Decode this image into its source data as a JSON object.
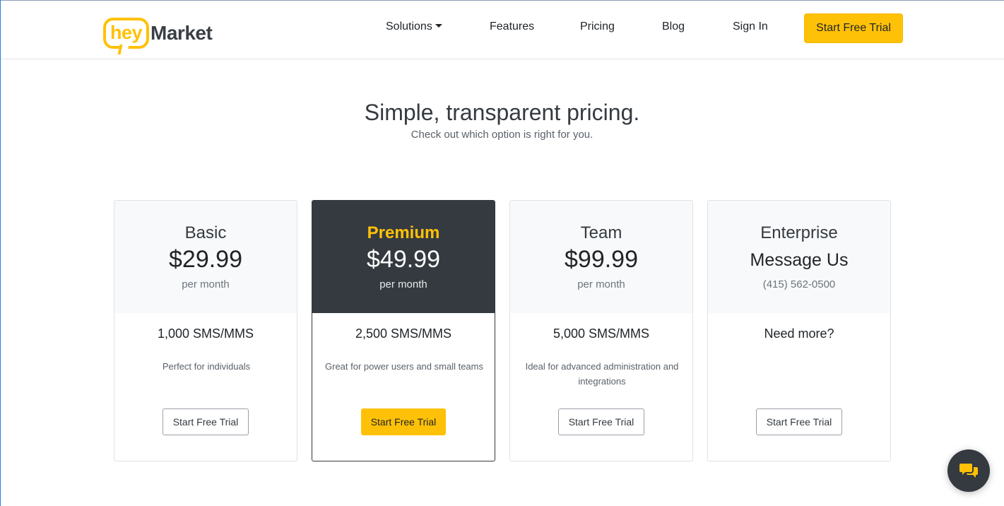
{
  "colors": {
    "brand_yellow": "#ffc107",
    "dark": "#343a40",
    "border": "#dfe2e5"
  },
  "logo": {
    "hey": "hey",
    "market": "Market"
  },
  "nav": {
    "items": [
      {
        "label": "Solutions",
        "has_dropdown": true,
        "icon": "caret-down-icon"
      },
      {
        "label": "Features"
      },
      {
        "label": "Pricing"
      },
      {
        "label": "Blog"
      },
      {
        "label": "Sign In"
      }
    ],
    "cta_label": "Start Free Trial"
  },
  "hero": {
    "title": "Simple, transparent pricing.",
    "subtitle": "Check out which option is right for you."
  },
  "plans": [
    {
      "name": "Basic",
      "price": "$29.99",
      "period": "per month",
      "volume": "1,000 SMS/MMS",
      "description": "Perfect for individuals",
      "button": "Start Free Trial",
      "highlighted": false
    },
    {
      "name": "Premium",
      "price": "$49.99",
      "period": "per month",
      "volume": "2,500 SMS/MMS",
      "description": "Great for power users and small teams",
      "button": "Start Free Trial",
      "highlighted": true
    },
    {
      "name": "Team",
      "price": "$99.99",
      "period": "per month",
      "volume": "5,000 SMS/MMS",
      "description": "Ideal for advanced administration and integrations",
      "button": "Start Free Trial",
      "highlighted": false
    },
    {
      "name": "Enterprise",
      "price": "Message Us",
      "period": "(415) 562-0500",
      "volume": "Need more?",
      "description": "",
      "button": "Start Free Trial",
      "highlighted": false
    }
  ],
  "chat": {
    "icon": "chat-bubbles-icon"
  }
}
